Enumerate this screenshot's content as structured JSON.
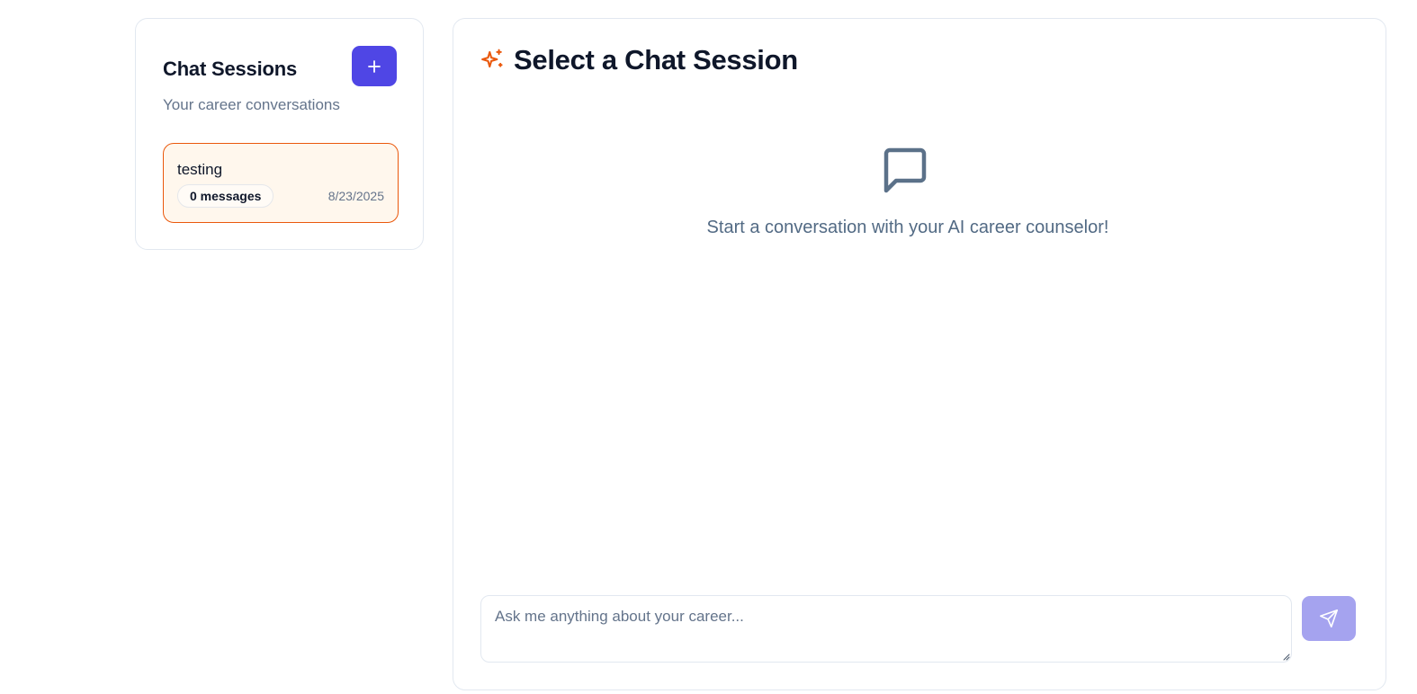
{
  "sidebar": {
    "title": "Chat Sessions",
    "subtitle": "Your career conversations",
    "new_session_icon": "plus-icon",
    "sessions": [
      {
        "name": "testing",
        "message_count": "0 messages",
        "date": "8/23/2025",
        "selected": true
      }
    ]
  },
  "main": {
    "title": "Select a Chat Session",
    "title_icon": "sparkles-icon",
    "empty_state": {
      "icon": "message-square-icon",
      "text": "Start a conversation with your AI career counselor!"
    },
    "composer": {
      "placeholder": "Ask me anything about your career...",
      "value": "",
      "send_icon": "send-icon"
    }
  },
  "colors": {
    "accent": "#4f46e5",
    "send_disabled": "#a5a3ef",
    "selected_border": "#ea580c",
    "selected_bg": "#fff7ed",
    "sparkle": "#ea580c",
    "muted_text": "#64748b"
  }
}
